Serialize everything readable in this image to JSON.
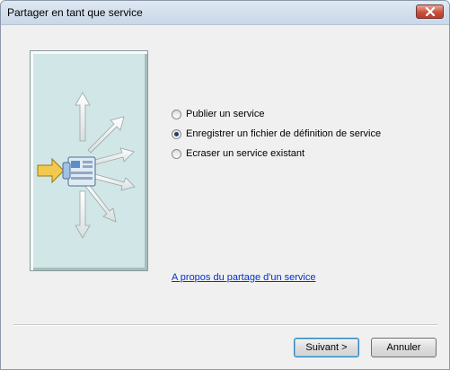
{
  "window": {
    "title": "Partager en tant que service"
  },
  "options": [
    {
      "label": "Publier un service",
      "checked": false
    },
    {
      "label": "Enregistrer un fichier de définition de service",
      "checked": true
    },
    {
      "label": "Ecraser un service existant",
      "checked": false
    }
  ],
  "link": {
    "label": "A propos du partage d'un service"
  },
  "buttons": {
    "next_label": "Suivant >",
    "cancel_label": "Annuler"
  },
  "colors": {
    "banner_bg": "#d1e6e6",
    "link": "#0033cc",
    "arrow_in": "#f2c94c"
  },
  "icons": {
    "close": "close-icon",
    "illustration": "share-service-illustration"
  }
}
